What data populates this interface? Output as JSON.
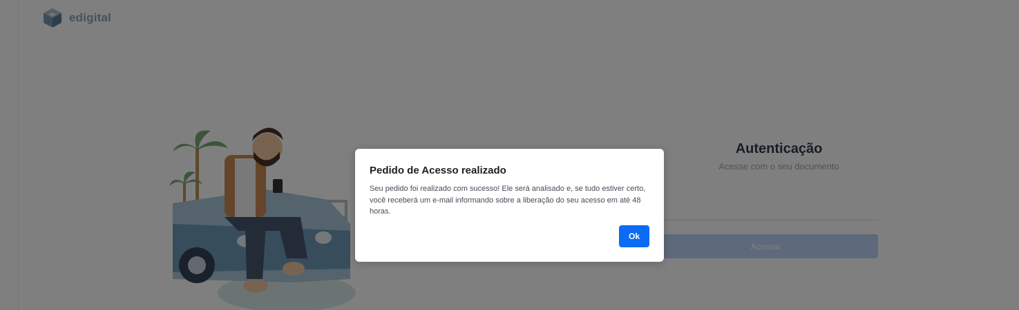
{
  "brand": {
    "name": "edigital",
    "logo_icon": "cube-logo-icon"
  },
  "auth": {
    "title": "Autenticação",
    "subtitle": "Acesse com o seu documento",
    "document_value": "",
    "access_button": "Acessar"
  },
  "modal": {
    "title": "Pedido de Acesso realizado",
    "message": "Seu pedido foi realizado com sucesso! Ele será analisado e, se tudo estiver certo, você receberá um e-mail informando sobre a liberação do seu acesso em até 48 horas.",
    "ok_label": "Ok"
  },
  "colors": {
    "primary": "#0b6bf2",
    "overlay": "rgba(0,0,0,0.5)"
  }
}
